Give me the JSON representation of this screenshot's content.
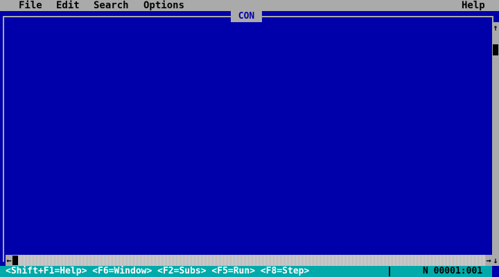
{
  "menu": {
    "file": "File",
    "edit": "Edit",
    "search": "Search",
    "options": "Options",
    "help": "Help"
  },
  "window": {
    "title": "CON"
  },
  "scrollbar": {
    "up_arrow": "↑",
    "down_arrow": "↓",
    "left_arrow": "←",
    "right_arrow": "→"
  },
  "status": {
    "keys": "<Shift+F1=Help> <F6=Window> <F2=Subs> <F5=Run> <F8=Step>",
    "cursor": "N 00001:001"
  },
  "colors": {
    "background": "#0000aa",
    "menubar": "#aaaaaa",
    "statusbar": "#00aaaa"
  }
}
